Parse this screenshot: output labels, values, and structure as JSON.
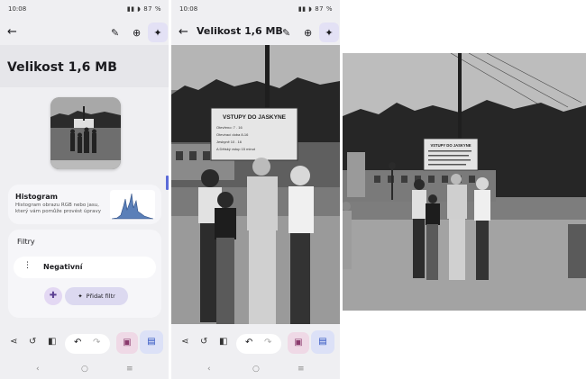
{
  "status": {
    "time": "10:08",
    "battery": "87 %"
  },
  "screen1": {
    "title": "Velikost 1,6 MB",
    "histogram": {
      "title": "Histogram",
      "description": "Histogram obrazu RGB nebo jasu, který vám pomůže provést úpravy"
    },
    "filters": {
      "title": "Filtry",
      "items": [
        "Negativní"
      ],
      "add_label": "Přidat filtr"
    }
  },
  "screen2": {
    "title": "Velikost 1,6 MB"
  },
  "photo": {
    "sign_lines": [
      "VSTUPY DO JASKYNE",
      "Otevřeno: 7 . 16",
      "Otevírací doba 8-16",
      "Jeskyně 10 . 16",
      "A Dětský vstup 15 minut"
    ]
  },
  "colors": {
    "accent": "#5b6bd8",
    "magic_bg": "#e3e1f5"
  }
}
